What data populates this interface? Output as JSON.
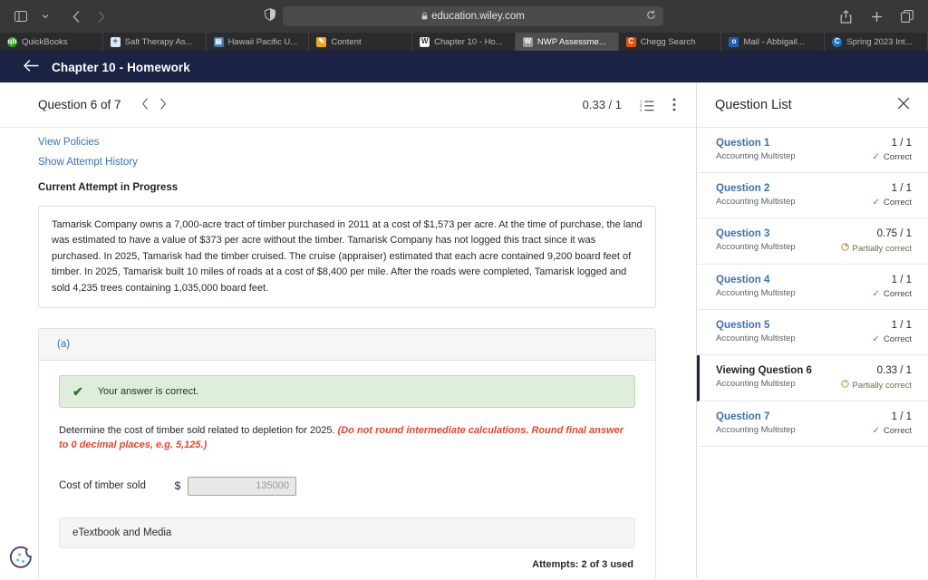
{
  "browser": {
    "address": "education.wiley.com",
    "lock_icon": "lock-icon",
    "shield_icon": "privacy-shield-icon",
    "reload_icon": "reload-icon",
    "back_icon": "back-icon",
    "forward_icon": "forward-icon",
    "sidebar_icon": "sidebar-toggle-icon",
    "share_icon": "share-icon",
    "newtab_icon": "new-tab-icon",
    "tabs_icon": "tab-overview-icon",
    "tabs": [
      {
        "label": "QuickBooks",
        "favicon": "quickbooks-favicon",
        "active": false
      },
      {
        "label": "Salt Therapy As...",
        "favicon": "salt-therapy-favicon",
        "active": false
      },
      {
        "label": "Hawaii Pacific U...",
        "favicon": "hawaii-pacific-favicon",
        "active": false
      },
      {
        "label": "Content",
        "favicon": "content-favicon",
        "active": false
      },
      {
        "label": "Chapter 10 - Ho...",
        "favicon": "wiley-favicon",
        "active": false
      },
      {
        "label": "NWP Assessme...",
        "favicon": "nwp-favicon",
        "active": true
      },
      {
        "label": "Chegg Search",
        "favicon": "chegg-favicon",
        "active": false
      },
      {
        "label": "Mail - Abbigail...",
        "favicon": "outlook-favicon",
        "active": false
      },
      {
        "label": "Spring 2023 Int...",
        "favicon": "canvas-favicon",
        "active": false
      }
    ]
  },
  "app_header": {
    "back_label": "back-arrow",
    "title": "Chapter 10 - Homework"
  },
  "question_bar": {
    "title": "Question 6 of 7",
    "prev_icon": "chevron-left-icon",
    "next_icon": "chevron-right-icon",
    "score": "0.33 / 1",
    "list_icon": "question-list-icon",
    "more_icon": "more-options-icon"
  },
  "content": {
    "view_policies": "View Policies",
    "show_attempt_history": "Show Attempt History",
    "attempt_status": "Current Attempt in Progress",
    "stem": "Tamarisk Company owns a 7,000-acre tract of timber purchased in 2011 at a cost of $1,573 per acre. At the time of purchase, the land was estimated to have a value of $373 per acre without the timber. Tamarisk Company has not logged this tract since it was purchased. In 2025, Tamarisk had the timber cruised. The cruise (appraiser) estimated that each acre contained 9,200 board feet of timber. In 2025, Tamarisk built 10 miles of roads at a cost of $8,400 per mile. After the roads were completed, Tamarisk logged and sold 4,235 trees containing 1,035,000 board feet.",
    "part_label": "(a)",
    "alert": {
      "icon": "checkmark-icon",
      "text": "Your answer is correct."
    },
    "prompt_main": "Determine the cost of timber sold related to depletion for 2025. ",
    "prompt_hint": "(Do not round intermediate calculations. Round final answer to 0 decimal places, e.g. 5,125.)",
    "answer": {
      "label": "Cost of timber sold",
      "currency": "$",
      "value": "135000",
      "placeholder": "135000"
    },
    "etextbook": "eTextbook and Media",
    "attempts": "Attempts: 2 of 3 used"
  },
  "question_list": {
    "title": "Question List",
    "close_icon": "close-icon",
    "items": [
      {
        "name": "Question 1",
        "sub": "Accounting Multistep",
        "score": "1 / 1",
        "status": "Correct",
        "status_type": "correct",
        "current": false
      },
      {
        "name": "Question 2",
        "sub": "Accounting Multistep",
        "score": "1 / 1",
        "status": "Correct",
        "status_type": "correct",
        "current": false
      },
      {
        "name": "Question 3",
        "sub": "Accounting Multistep",
        "score": "0.75 / 1",
        "status": "Partially correct",
        "status_type": "partial",
        "current": false
      },
      {
        "name": "Question 4",
        "sub": "Accounting Multistep",
        "score": "1 / 1",
        "status": "Correct",
        "status_type": "correct",
        "current": false
      },
      {
        "name": "Question 5",
        "sub": "Accounting Multistep",
        "score": "1 / 1",
        "status": "Correct",
        "status_type": "correct",
        "current": false
      },
      {
        "name": "Viewing Question 6",
        "sub": "Accounting Multistep",
        "score": "0.33 / 1",
        "status": "Partially correct",
        "status_type": "partial",
        "current": true
      },
      {
        "name": "Question 7",
        "sub": "Accounting Multistep",
        "score": "1 / 1",
        "status": "Correct",
        "status_type": "correct",
        "current": false
      }
    ]
  },
  "cookie_widget": {
    "icon": "cookie-consent-icon"
  },
  "colors": {
    "brand_navy": "#1b2244",
    "link_blue": "#3a72b0",
    "hint_red": "#e8442a",
    "correct_green": "#dfeedb",
    "partial_gold": "#b9a05e"
  }
}
